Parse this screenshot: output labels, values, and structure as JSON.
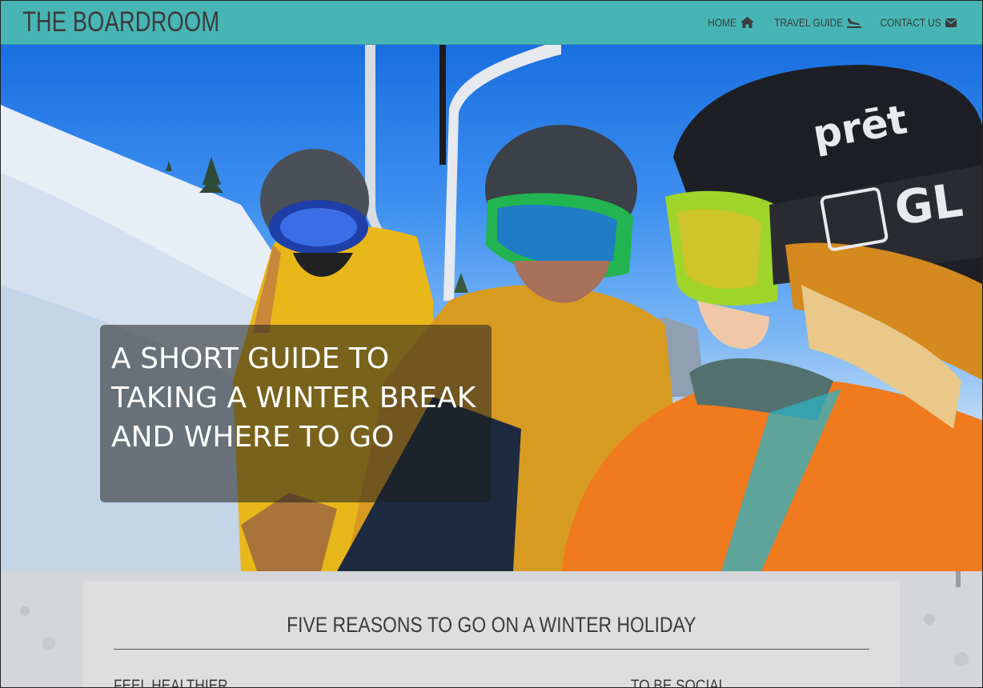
{
  "brand": "THE BOARDROOM",
  "nav": {
    "home": "HOME",
    "travel": "TRAVEL GUIDE",
    "contact": "CONTACT US"
  },
  "icons": {
    "home": "home-icon",
    "travel": "plane-landing-icon",
    "contact": "envelope-icon",
    "feel_healthier": "heart-icon",
    "to_be_social": "binoculars-icon"
  },
  "hero": {
    "title": "A SHORT GUIDE TO TAKING A WINTER BREAK AND WHERE TO GO",
    "helmet_brand": "prēt",
    "goggle_brand": "GL"
  },
  "section": {
    "title": "FIVE REASONS TO GO ON A WINTER HOLIDAY",
    "reasons": [
      "FEEL HEALTHIER",
      "TO BE SOCIAL"
    ]
  },
  "colors": {
    "nav_bg": "#48b5b5",
    "text": "#3b3b3b"
  }
}
